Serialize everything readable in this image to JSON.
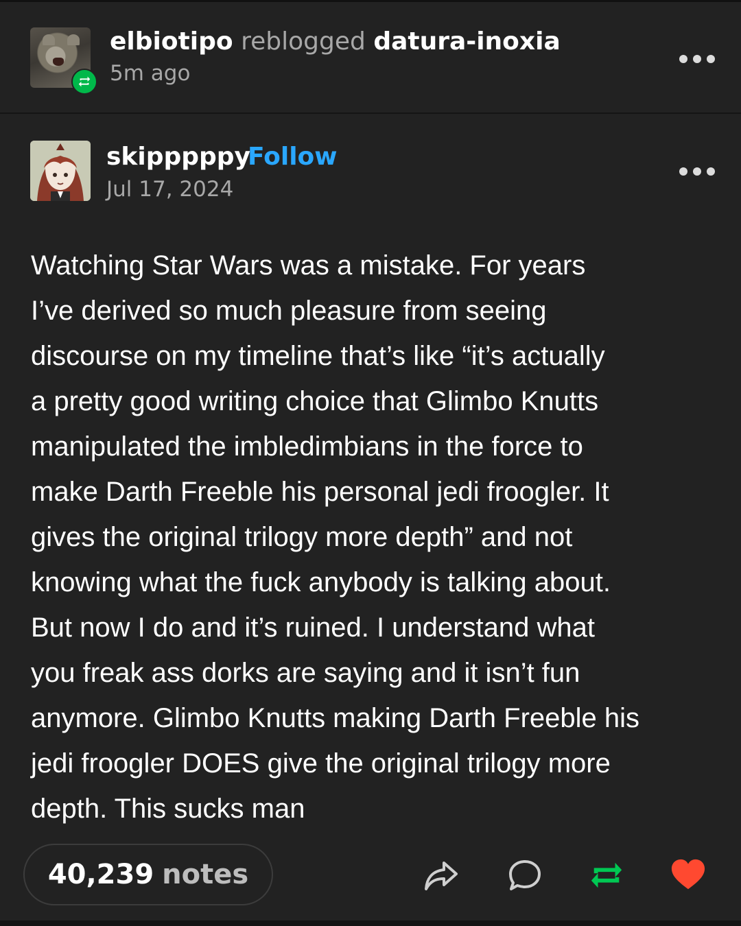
{
  "reblog": {
    "reblogger": "elbiotipo",
    "action_word": "reblogged",
    "source": "datura-inoxia",
    "time": "5m ago"
  },
  "post": {
    "username": "skipppppy",
    "follow_label": "Follow",
    "date": "Jul 17, 2024",
    "body_lines": [
      "Watching Star Wars was a mistake. For years",
      "I’ve derived so much pleasure from seeing",
      "discourse on my timeline that’s like “it’s actually",
      "a pretty good writing choice that Glimbo Knutts",
      "manipulated the imbledimbians in the force to",
      "make Darth Freeble his personal jedi froogler. It",
      "gives the original trilogy more depth” and not",
      "knowing what the fuck anybody is talking about.",
      "But now I do and it’s ruined. I understand what",
      "you freak ass dorks are saying and it isn’t fun",
      "anymore. Glimbo Knutts making Darth Freeble his",
      "jedi froogler DOES give the original trilogy more",
      "depth. This sucks man"
    ]
  },
  "footer": {
    "notes_count": "40,239",
    "notes_label": "notes"
  },
  "icons": {
    "more": "more-horizontal-icon",
    "share": "share-icon",
    "reply": "comment-icon",
    "reblog": "reblog-icon",
    "like": "heart-icon"
  },
  "colors": {
    "background": "#222222",
    "follow": "#2aa7ff",
    "reblog_green": "#00b84a",
    "heart_red": "#ff4930",
    "muted_text": "#a8a8a8"
  }
}
